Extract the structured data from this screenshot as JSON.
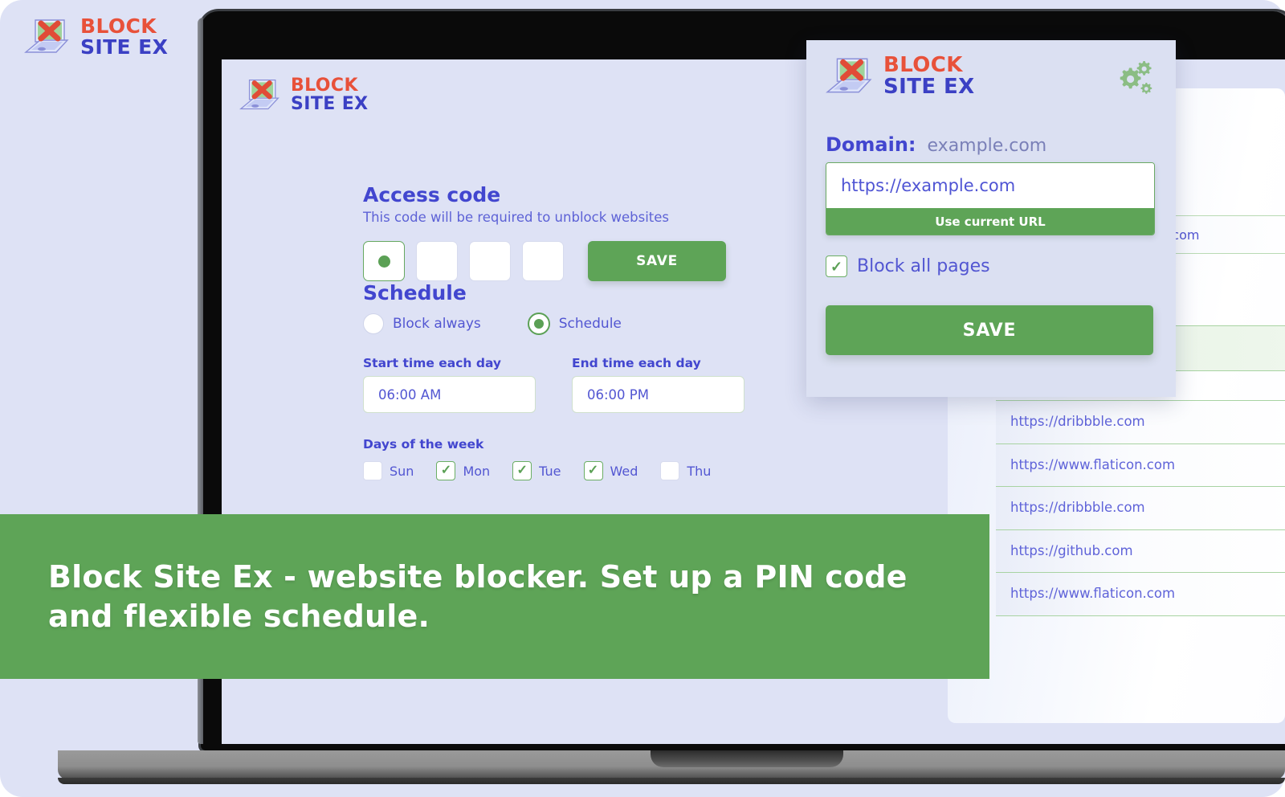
{
  "brand": {
    "line1": "BLOCK",
    "line2": "SITE EX",
    "logo_icon": "laptop-with-red-x-icon"
  },
  "caption": {
    "text": "Block Site Ex - website blocker. Set up a PIN code and flexible schedule."
  },
  "options_page": {
    "access_code": {
      "title": "Access code",
      "subtitle": "This code will be required to unblock websites",
      "pin_boxes": [
        {
          "filled": true
        },
        {
          "filled": false
        },
        {
          "filled": false
        },
        {
          "filled": false
        }
      ],
      "save_label": "SAVE"
    },
    "schedule": {
      "title": "Schedule",
      "modes": [
        {
          "label": "Block always",
          "selected": false
        },
        {
          "label": "Schedule",
          "selected": true
        }
      ],
      "start_label": "Start time each day",
      "start_value": "06:00 AM",
      "end_label": "End time each day",
      "end_value": "06:00 PM",
      "days_label": "Days of the week",
      "days": [
        {
          "label": "Sun",
          "checked": false
        },
        {
          "label": "Mon",
          "checked": true
        },
        {
          "label": "Tue",
          "checked": true
        },
        {
          "label": "Wed",
          "checked": true
        },
        {
          "label": "Thu",
          "checked": false
        }
      ]
    }
  },
  "popup": {
    "settings_icon": "gear-icon",
    "domain_key": "Domain:",
    "domain_value": "example.com",
    "url_value": "https://example.com",
    "use_current_url_label": "Use current URL",
    "block_all_pages_label": "Block all pages",
    "block_all_pages_checked": true,
    "save_label": "SAVE"
  },
  "blocked_list": {
    "input_value": "https://example.com",
    "items": [
      "https://dribbble.com",
      "https://www.flaticon.com",
      "https://dribbble.com",
      "https://github.com",
      "https://www.flaticon.com"
    ]
  },
  "colors": {
    "accent_green": "#5ea457",
    "brand_red": "#e8513a",
    "brand_blue": "#3b40c4",
    "page_lavender": "#dee2f5"
  }
}
